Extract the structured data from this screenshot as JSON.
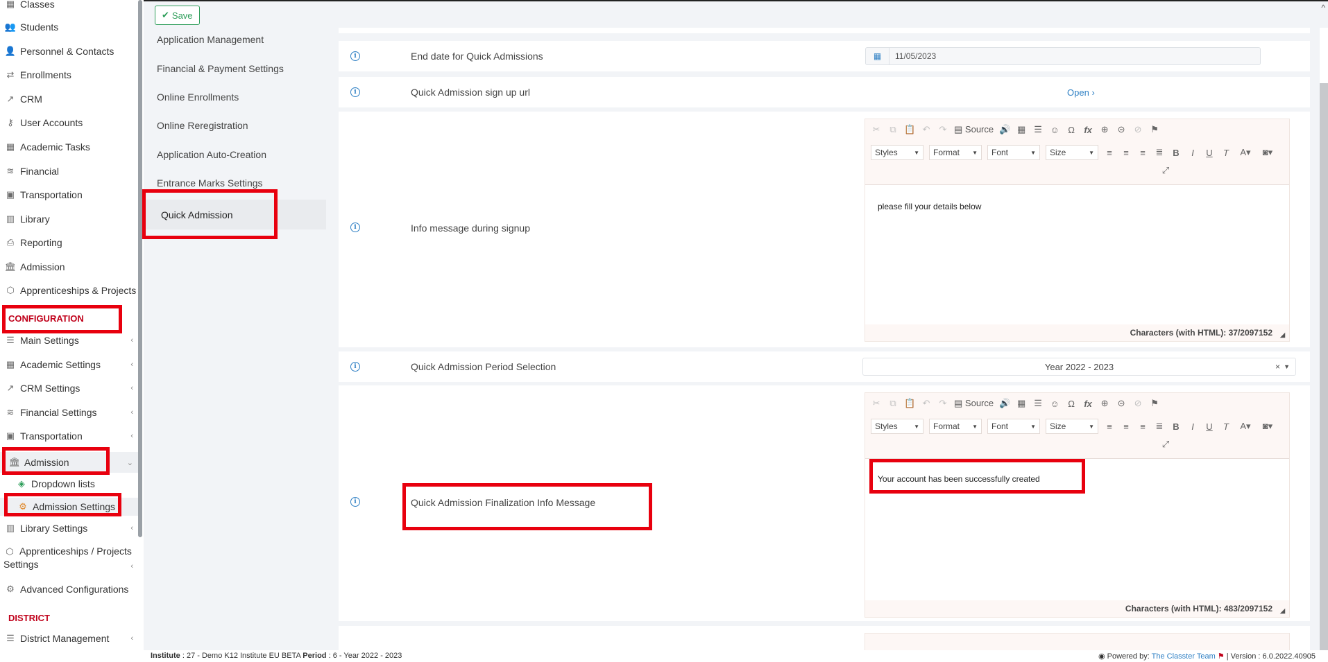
{
  "sidebar": {
    "items": [
      {
        "label": "Classes",
        "icon": "classes-icon"
      },
      {
        "label": "Students",
        "icon": "students-icon"
      },
      {
        "label": "Personnel & Contacts",
        "icon": "personnel-icon"
      },
      {
        "label": "Enrollments",
        "icon": "enrollments-icon"
      },
      {
        "label": "CRM",
        "icon": "crm-icon"
      },
      {
        "label": "User Accounts",
        "icon": "key-icon"
      },
      {
        "label": "Academic Tasks",
        "icon": "tasks-icon"
      },
      {
        "label": "Financial",
        "icon": "coins-icon"
      },
      {
        "label": "Transportation",
        "icon": "bus-icon"
      },
      {
        "label": "Library",
        "icon": "books-icon"
      },
      {
        "label": "Reporting",
        "icon": "printer-icon"
      },
      {
        "label": "Admission",
        "icon": "building-icon"
      },
      {
        "label": "Apprenticeships & Projects",
        "icon": "cube-icon"
      }
    ],
    "configuration_heading": "CONFIGURATION",
    "config_items": [
      {
        "label": "Main Settings",
        "icon": "sliders-icon"
      },
      {
        "label": "Academic Settings",
        "icon": "classes-icon"
      },
      {
        "label": "CRM Settings",
        "icon": "crm-icon"
      },
      {
        "label": "Financial Settings",
        "icon": "coins-icon"
      },
      {
        "label": "Transportation",
        "icon": "bus-icon"
      },
      {
        "label": "Admission",
        "icon": "building-icon"
      },
      {
        "label": "Dropdown lists",
        "icon": "layers-icon"
      },
      {
        "label": "Admission Settings",
        "icon": "gear-icon"
      },
      {
        "label": "Library Settings",
        "icon": "books-icon"
      },
      {
        "label": "Apprenticeships / Projects Settings",
        "icon": "cube-icon"
      },
      {
        "label": "Advanced Configurations",
        "icon": "gears-icon"
      }
    ],
    "district_heading": "DISTRICT",
    "district_items": [
      {
        "label": "District Management",
        "icon": "menu-icon"
      }
    ]
  },
  "subnav": {
    "items": [
      "Application Management",
      "Financial & Payment Settings",
      "Online Enrollments",
      "Online Reregistration",
      "Application Auto-Creation",
      "Entrance Marks Settings",
      "Quick Admission"
    ],
    "active": "Quick Admission"
  },
  "toolbar": {
    "save_label": "Save"
  },
  "settings": {
    "end_date": {
      "label": "End date for Quick Admissions",
      "value": "11/05/2023"
    },
    "signup_url": {
      "label": "Quick Admission sign up url",
      "link": "Open"
    },
    "info_message": {
      "label": "Info message during signup",
      "content": "please fill your details below",
      "char_count": "Characters (with HTML): 37/2097152"
    },
    "period": {
      "label": "Quick Admission Period Selection",
      "value": "Year 2022 - 2023"
    },
    "finalization": {
      "label": "Quick Admission Finalization Info Message",
      "content": "Your account has been successfully created",
      "char_count": "Characters (with HTML): 483/2097152"
    }
  },
  "editor_toolbar": {
    "source_label": "Source",
    "styles": "Styles",
    "format": "Format",
    "font": "Font",
    "size": "Size"
  },
  "status": {
    "institute_label": "Institute",
    "institute_value": ": 27 - Demo K12 Institute EU BETA",
    "period_label": "Period",
    "period_value": ": 6 - Year 2022 - 2023",
    "powered_by": "Powered by:",
    "team": "The Classter Team",
    "version": "| Version : 6.0.2022.40905"
  },
  "colors": {
    "accent": "#2d7fc4",
    "highlight": "#e8000e",
    "save_green": "#2e9e5a",
    "section_red": "#c0001a"
  }
}
